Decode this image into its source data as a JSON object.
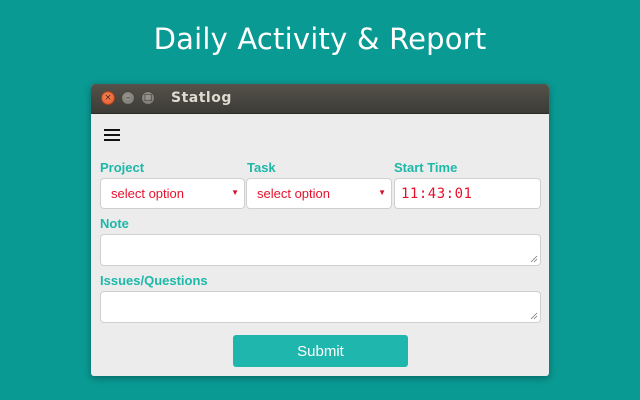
{
  "headline": "Daily Activity & Report",
  "window": {
    "title": "Statlog",
    "controls": {
      "close_glyph": "×",
      "minimize_glyph": "–",
      "maximize_glyph": "□"
    }
  },
  "form": {
    "menu_icon": "hamburger-menu-icon",
    "project": {
      "label": "Project",
      "selected": "select option"
    },
    "task": {
      "label": "Task",
      "selected": "select option"
    },
    "start_time": {
      "label": "Start Time",
      "value": "11:43:01"
    },
    "note": {
      "label": "Note",
      "value": ""
    },
    "issues": {
      "label": "Issues/Questions",
      "value": ""
    },
    "submit_label": "Submit"
  },
  "colors": {
    "background": "#0a9a94",
    "accent": "#1db8a8",
    "select_text": "#e8112d",
    "submit_bg": "#1fb7ad"
  }
}
